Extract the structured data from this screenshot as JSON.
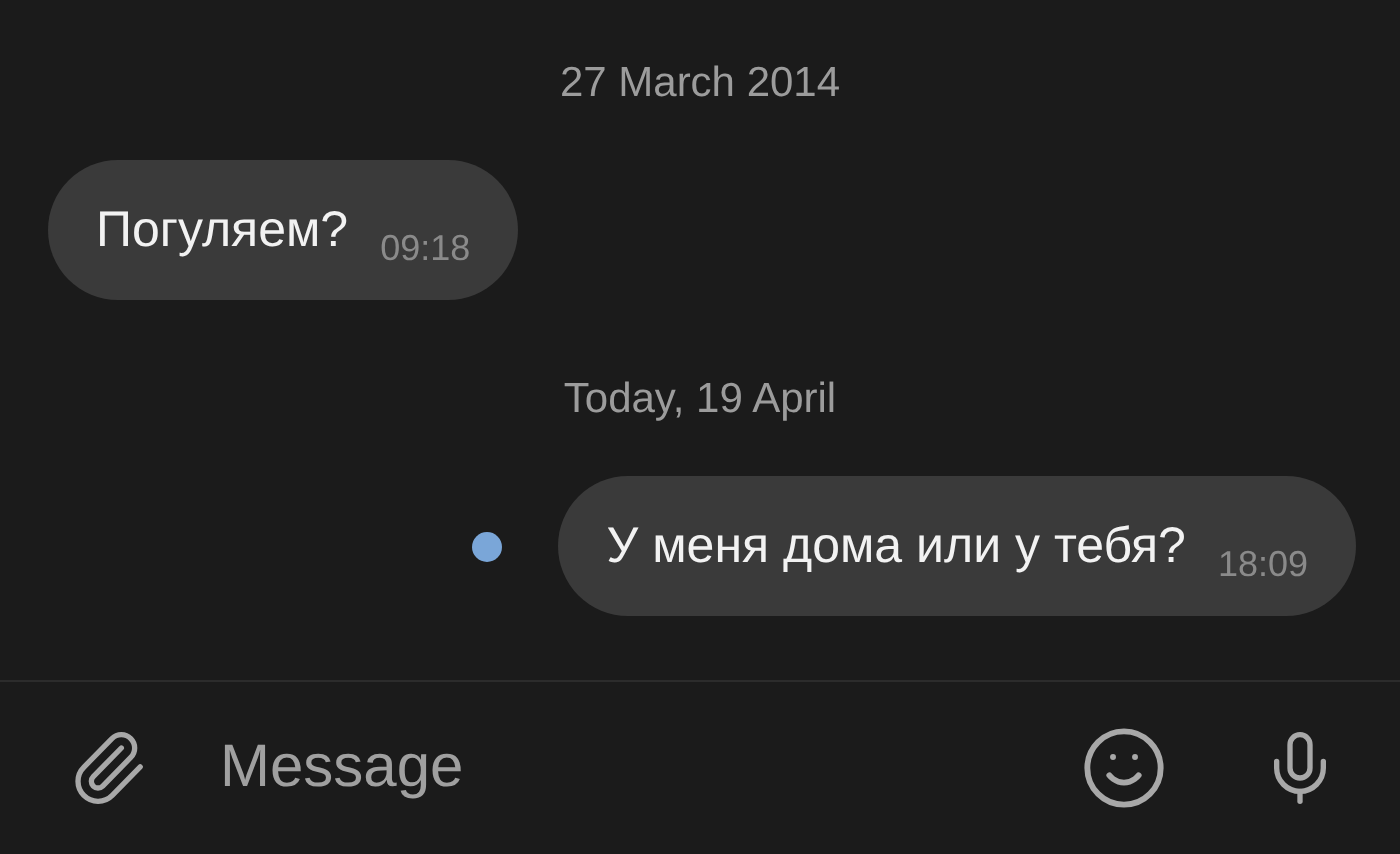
{
  "timeline": [
    {
      "kind": "date",
      "text": "27 March 2014"
    },
    {
      "kind": "incoming",
      "text": "Погуляем?",
      "time": "09:18",
      "unread": false
    },
    {
      "kind": "date",
      "text": "Today, 19 April"
    },
    {
      "kind": "outgoing",
      "text": "У меня дома или у тебя?",
      "time": "18:09",
      "unread": true
    }
  ],
  "composer": {
    "placeholder": "Message"
  }
}
